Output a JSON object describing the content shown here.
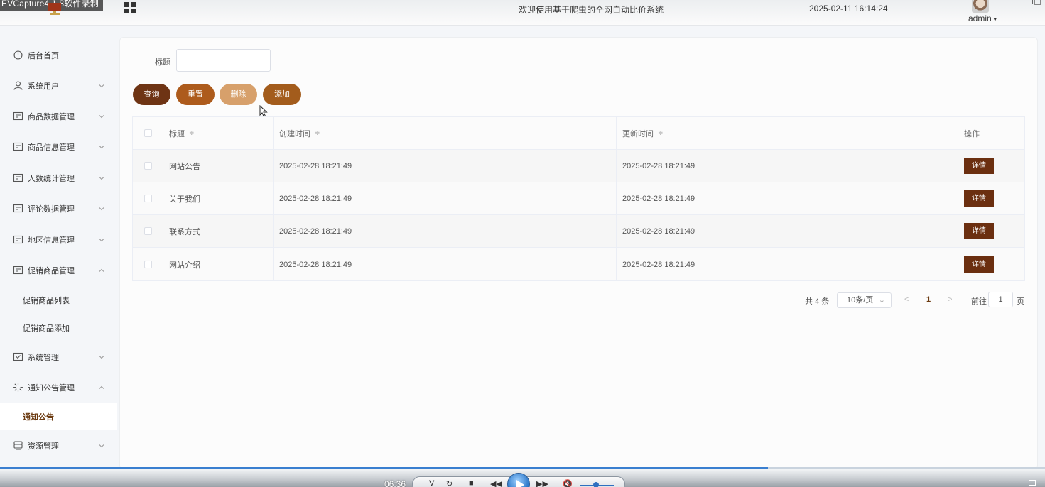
{
  "recorder": {
    "title": "EVCapture4.1.8软件录制"
  },
  "header": {
    "welcome": "欢迎使用基于爬虫的全网自动比价系统",
    "datetime": "2025-02-11 16:14:24",
    "user": "admin"
  },
  "sidebar": {
    "items": [
      {
        "label": "后台首页",
        "icon": "dashboard-icon"
      },
      {
        "label": "系统用户",
        "icon": "user-icon",
        "arrow": "down"
      },
      {
        "label": "商品数据管理",
        "icon": "list-icon",
        "arrow": "down"
      },
      {
        "label": "商品信息管理",
        "icon": "list-icon",
        "arrow": "down"
      },
      {
        "label": "人数统计管理",
        "icon": "list-icon",
        "arrow": "down"
      },
      {
        "label": "评论数据管理",
        "icon": "list-icon",
        "arrow": "down"
      },
      {
        "label": "地区信息管理",
        "icon": "list-icon",
        "arrow": "down"
      },
      {
        "label": "促销商品管理",
        "icon": "list-icon",
        "arrow": "up"
      },
      {
        "label": "系统管理",
        "icon": "check-box-icon",
        "arrow": "down"
      },
      {
        "label": "通知公告管理",
        "icon": "loading-icon",
        "arrow": "up"
      },
      {
        "label": "资源管理",
        "icon": "storage-icon",
        "arrow": "down"
      }
    ],
    "promo_sub": [
      "促销商品列表",
      "促销商品添加"
    ],
    "notice_sub": [
      "通知公告"
    ]
  },
  "search": {
    "label": "标题",
    "value": ""
  },
  "buttons": {
    "query": "查询",
    "reset": "重置",
    "delete": "删除",
    "add": "添加"
  },
  "table": {
    "headers": [
      "标题",
      "创建时间",
      "更新时间",
      "操作"
    ],
    "rows": [
      {
        "title": "网站公告",
        "created": "2025-02-28 18:21:49",
        "updated": "2025-02-28 18:21:49",
        "action": "详情"
      },
      {
        "title": "关于我们",
        "created": "2025-02-28 18:21:49",
        "updated": "2025-02-28 18:21:49",
        "action": "详情"
      },
      {
        "title": "联系方式",
        "created": "2025-02-28 18:21:49",
        "updated": "2025-02-28 18:21:49",
        "action": "详情"
      },
      {
        "title": "网站介绍",
        "created": "2025-02-28 18:21:49",
        "updated": "2025-02-28 18:21:49",
        "action": "详情"
      }
    ]
  },
  "pagination": {
    "total": "共 4 条",
    "page_size": "10条/页",
    "prev": "<",
    "current": "1",
    "next": ">",
    "goto_label": "前往",
    "goto_value": "1",
    "page_suffix": "页"
  },
  "player": {
    "time": "06:36",
    "progress_fraction": 0.735,
    "volume_fraction": 0.45
  },
  "colors": {
    "primary_dark": "#6e3414",
    "primary": "#ad5b1c",
    "primary_light": "#d7a06b",
    "active_text": "#6b3a10"
  }
}
